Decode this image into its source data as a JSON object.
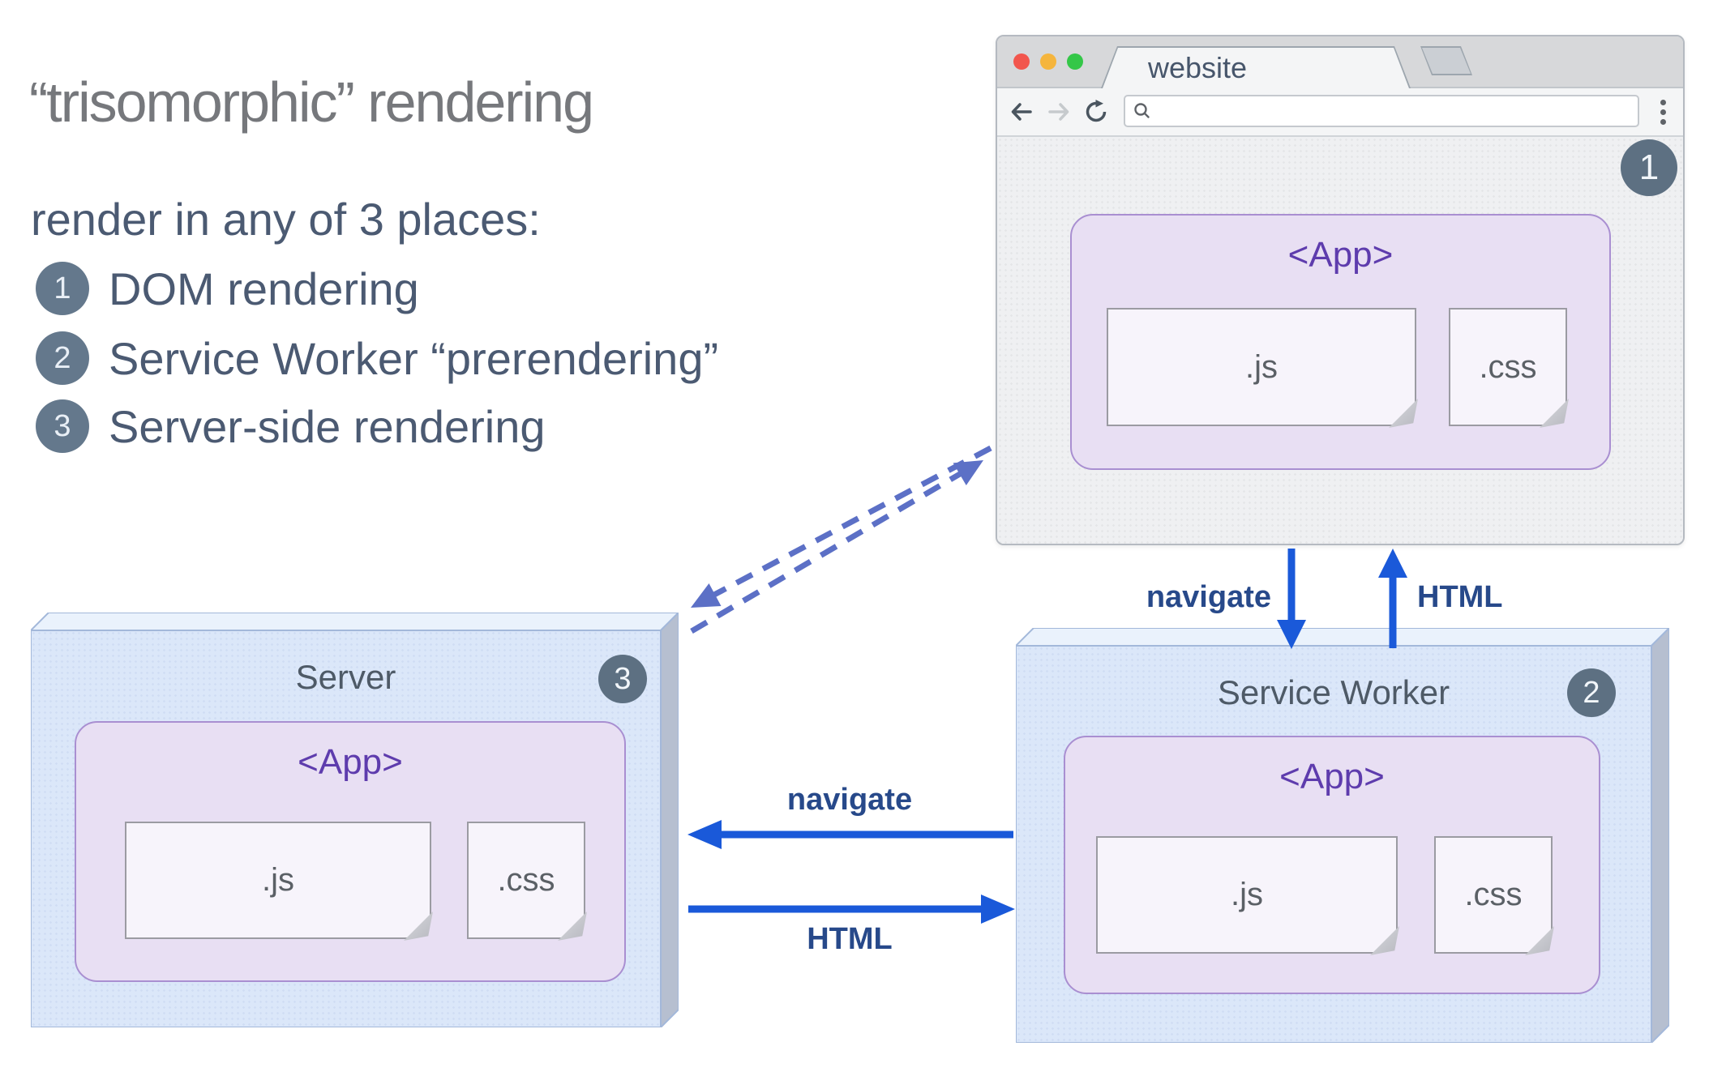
{
  "title": "“trisomorphic” rendering",
  "subtitle": "render in any of 3 places:",
  "legend": {
    "items": [
      {
        "num": "1",
        "label": "DOM rendering"
      },
      {
        "num": "2",
        "label": "Service Worker “prerendering”"
      },
      {
        "num": "3",
        "label": "Server-side rendering"
      }
    ]
  },
  "browser": {
    "tab_title": "website",
    "address_value": "",
    "badge": "1"
  },
  "app": {
    "title": "<App>",
    "js": ".js",
    "css": ".css"
  },
  "server": {
    "title": "Server",
    "badge": "3"
  },
  "service_worker": {
    "title": "Service Worker",
    "badge": "2"
  },
  "arrows": {
    "navigate_vertical": "navigate",
    "html_vertical": "HTML",
    "navigate_horizontal": "navigate",
    "html_horizontal": "HTML"
  },
  "colors": {
    "arrow_blue": "#1a59d9",
    "dashed_blue": "#5c70c6",
    "purple_text": "#5e3cad",
    "app_fill": "#e8dff3",
    "app_border": "#a98fd1",
    "box_face": "#dbe7f9",
    "box_top": "#eaf2fc",
    "box_side": "#b6bfd0",
    "badge_bg": "#5d7082",
    "slate_text": "#4b5a72",
    "title_gray": "#76787c"
  }
}
